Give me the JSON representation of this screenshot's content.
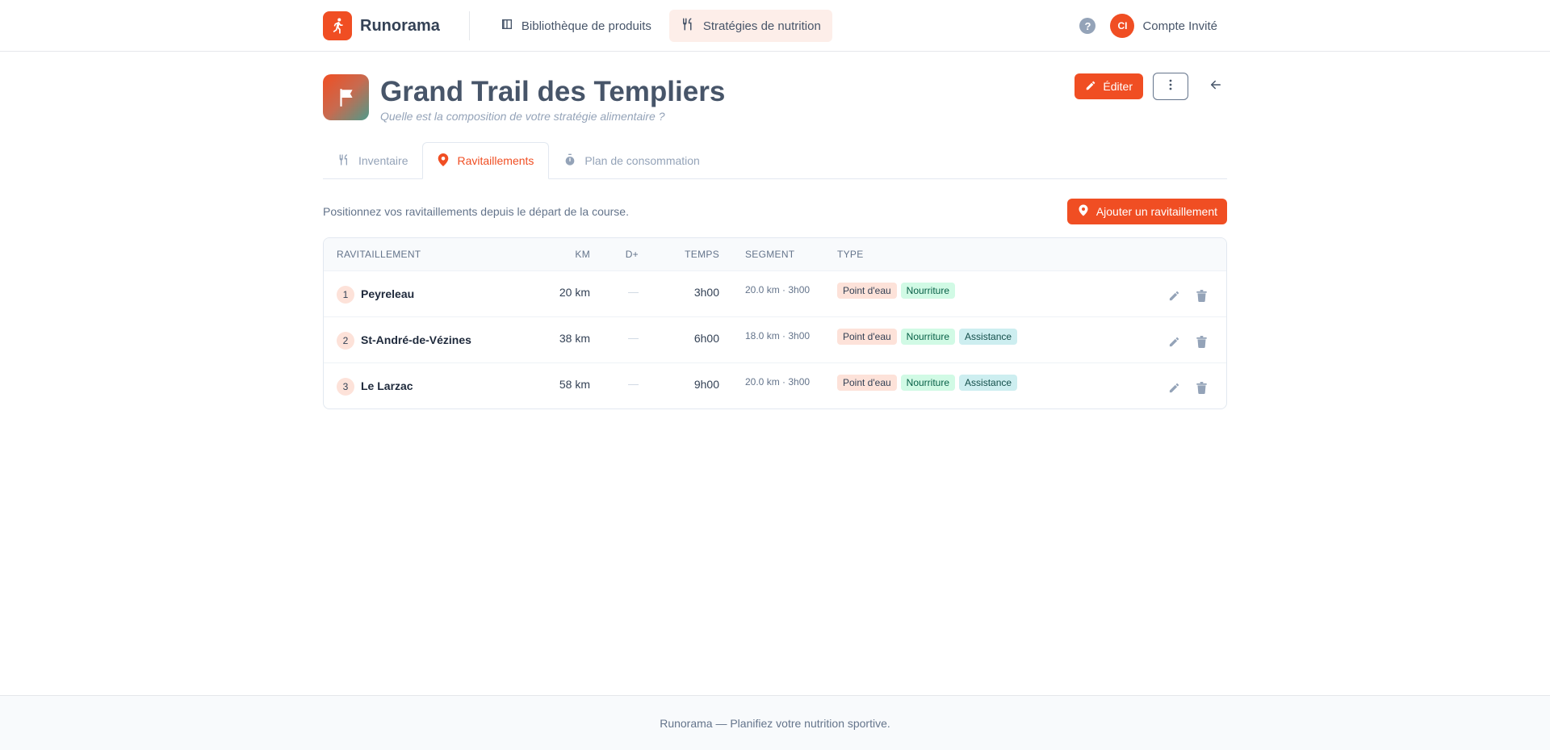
{
  "app": {
    "name": "Runorama"
  },
  "nav": {
    "items": [
      {
        "label": "Bibliothèque de produits",
        "icon": "book-icon",
        "active": false
      },
      {
        "label": "Stratégies de nutrition",
        "icon": "utensils-icon",
        "active": true
      }
    ],
    "help_label": "?",
    "account": {
      "initials": "CI",
      "label": "Compte Invité"
    }
  },
  "page": {
    "title": "Grand Trail des Templiers",
    "subtitle": "Quelle est la composition de votre stratégie alimentaire ?",
    "edit_label": "Éditer"
  },
  "tabs": [
    {
      "label": "Inventaire",
      "icon": "utensils-icon",
      "active": false
    },
    {
      "label": "Ravitaillements",
      "icon": "map-pin-icon",
      "active": true
    },
    {
      "label": "Plan de consommation",
      "icon": "stopwatch-icon",
      "active": false
    }
  ],
  "toolbar": {
    "hint": "Positionnez vos ravitaillements depuis le départ de la course.",
    "add_label": "Ajouter un ravitaillement"
  },
  "table": {
    "headers": {
      "name": "RAVITAILLEMENT",
      "km": "KM",
      "dplus": "D+",
      "time": "TEMPS",
      "segment": "SEGMENT",
      "type": "TYPE"
    },
    "rows": [
      {
        "num": "1",
        "name": "Peyreleau",
        "km": "20 km",
        "dplus": "—",
        "time": "3h00",
        "segment": "20.0 km · 3h00",
        "types": [
          "Point d'eau",
          "Nourriture"
        ]
      },
      {
        "num": "2",
        "name": "St-André-de-Vézines",
        "km": "38 km",
        "dplus": "—",
        "time": "6h00",
        "segment": "18.0 km · 3h00",
        "types": [
          "Point d'eau",
          "Nourriture",
          "Assistance"
        ]
      },
      {
        "num": "3",
        "name": "Le Larzac",
        "km": "58 km",
        "dplus": "—",
        "time": "9h00",
        "segment": "20.0 km · 3h00",
        "types": [
          "Point d'eau",
          "Nourriture",
          "Assistance"
        ]
      }
    ]
  },
  "footer": {
    "text": "Runorama — Planifiez votre nutrition sportive."
  },
  "colors": {
    "accent": "#f04e23"
  }
}
